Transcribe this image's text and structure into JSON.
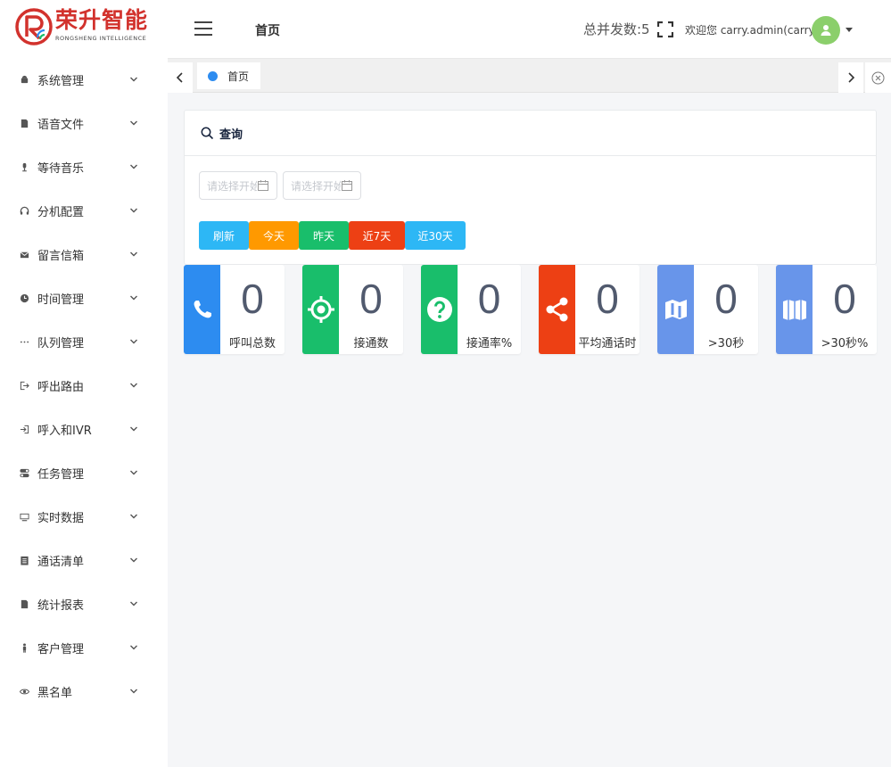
{
  "brand": {
    "name": "荣升智能",
    "subtitle": "RONGSHENG INTELLIGENCE",
    "color": "#d2322d"
  },
  "header": {
    "title": "首页",
    "concurrency": "总并发数:5",
    "welcome": "欢迎您 carry.admin(carryf)"
  },
  "sidebar": {
    "items": [
      {
        "label": "系统管理",
        "icon": "android-icon"
      },
      {
        "label": "语音文件",
        "icon": "document-icon"
      },
      {
        "label": "等待音乐",
        "icon": "microphone-icon"
      },
      {
        "label": "分机配置",
        "icon": "headset-icon"
      },
      {
        "label": "留言信箱",
        "icon": "mail-icon"
      },
      {
        "label": "时间管理",
        "icon": "clock-icon"
      },
      {
        "label": "队列管理",
        "icon": "ellipsis-icon"
      },
      {
        "label": "呼出路由",
        "icon": "sign-out-icon"
      },
      {
        "label": "呼入和IVR",
        "icon": "sign-in-icon"
      },
      {
        "label": "任务管理",
        "icon": "toggle-icon"
      },
      {
        "label": "实时数据",
        "icon": "monitor-icon"
      },
      {
        "label": "通话清单",
        "icon": "list-icon"
      },
      {
        "label": "统计报表",
        "icon": "report-icon"
      },
      {
        "label": "客户管理",
        "icon": "person-icon"
      },
      {
        "label": "黑名单",
        "icon": "eye-icon"
      }
    ]
  },
  "tabs": {
    "home_label": "首页",
    "active_color": "#2d8cf0"
  },
  "query": {
    "title": "查询",
    "start_placeholder": "请选择开始时间",
    "end_placeholder": "请选择开始时间",
    "buttons": [
      {
        "label": "刷新",
        "color": "#2db7f5"
      },
      {
        "label": "今天",
        "color": "#ff9900"
      },
      {
        "label": "昨天",
        "color": "#19be6b"
      },
      {
        "label": "近7天",
        "color": "#ed4014"
      },
      {
        "label": "近30天",
        "color": "#2db7f5"
      }
    ]
  },
  "stats": [
    {
      "value": "0",
      "label": "呼叫总数",
      "color": "#2d8cf0",
      "icon": "phone-icon"
    },
    {
      "value": "0",
      "label": "接通数",
      "color": "#19be6b",
      "icon": "target-icon"
    },
    {
      "value": "0",
      "label": "接通率%",
      "color": "#19be6b",
      "icon": "question-icon"
    },
    {
      "value": "0",
      "label": "平均通话时",
      "color": "#ed4014",
      "icon": "share-icon"
    },
    {
      "value": "0",
      "label": ">30秒",
      "color": "#6895ea",
      "icon": "map-icon"
    },
    {
      "value": "0",
      "label": ">30秒%",
      "color": "#6895ea",
      "icon": "map-folded-icon"
    }
  ]
}
